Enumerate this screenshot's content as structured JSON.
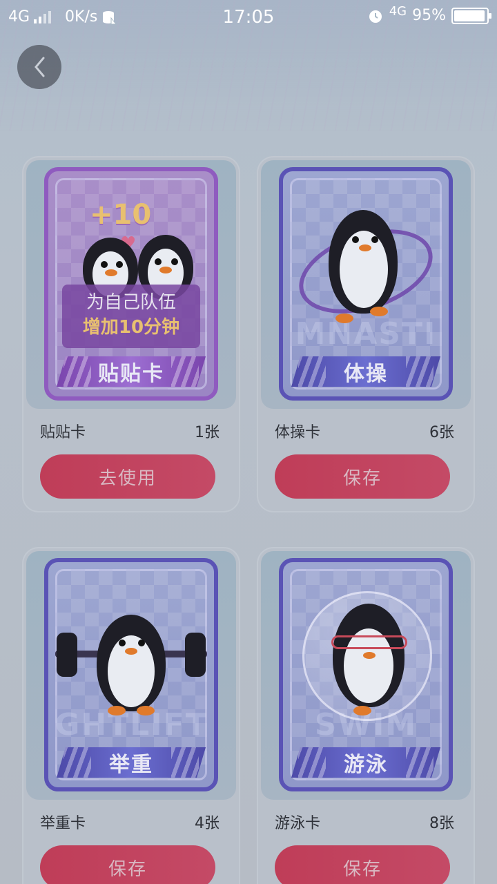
{
  "status_bar": {
    "network_left": "4G",
    "speed": "0K/s",
    "time": "17:05",
    "network_right": "4G",
    "battery": "95%",
    "battery_level": 0.95
  },
  "nav": {
    "back_icon": "chevron-left-icon"
  },
  "cards": [
    {
      "id": "tietie",
      "art_title": "贴贴卡",
      "bonus": "+10",
      "promo_line1": "为自己队伍",
      "promo_line2": "增加10分钟",
      "name": "贴贴卡",
      "count": "1张",
      "button": "去使用"
    },
    {
      "id": "ticao",
      "art_title": "体操",
      "watermark": "MNASTI",
      "name": "体操卡",
      "count": "6张",
      "button": "保存"
    },
    {
      "id": "juzhong",
      "art_title": "举重",
      "watermark": "GHTLIFT",
      "name": "举重卡",
      "count": "4张",
      "button": "保存"
    },
    {
      "id": "youyong",
      "art_title": "游泳",
      "watermark": "SWIM",
      "name": "游泳卡",
      "count": "8张",
      "button": "保存"
    }
  ],
  "colors": {
    "button": "#bf3d58",
    "overlay": "#b7c0cb",
    "card_frame_blue": "#5a53b5",
    "card_frame_purple": "#8f5bbf"
  }
}
